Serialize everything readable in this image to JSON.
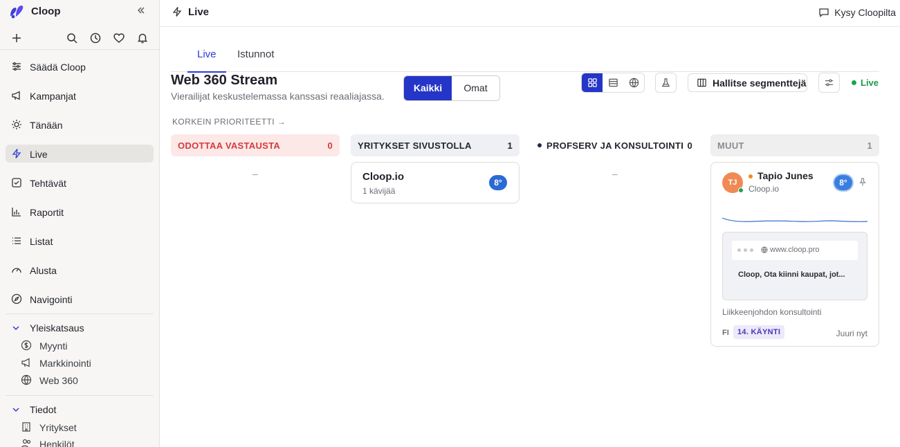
{
  "app": {
    "name": "Cloop",
    "accent": "#2535c7"
  },
  "sidebar": {
    "items": [
      {
        "label": "Säädä Cloop",
        "icon": "sliders-icon"
      },
      {
        "label": "Kampanjat",
        "icon": "megaphone-icon"
      },
      {
        "label": "Tänään",
        "icon": "sun-icon"
      },
      {
        "label": "Live",
        "icon": "bolt-icon",
        "active": true
      },
      {
        "label": "Tehtävät",
        "icon": "checkbox-icon"
      },
      {
        "label": "Raportit",
        "icon": "bar-chart-icon"
      },
      {
        "label": "Listat",
        "icon": "list-icon"
      },
      {
        "label": "Alusta",
        "icon": "gauge-icon"
      },
      {
        "label": "Navigointi",
        "icon": "compass-icon"
      }
    ],
    "groups": [
      {
        "label": "Yleiskatsaus",
        "items": [
          {
            "label": "Myynti",
            "icon": "dollar-icon"
          },
          {
            "label": "Markkinointi",
            "icon": "megaphone-icon"
          },
          {
            "label": "Web 360",
            "icon": "globe-icon"
          }
        ]
      },
      {
        "label": "Tiedot",
        "items": [
          {
            "label": "Yritykset",
            "icon": "building-icon"
          },
          {
            "label": "Henkilöt",
            "icon": "users-icon"
          }
        ]
      }
    ]
  },
  "topbar": {
    "title": "Live",
    "ask_label": "Kysy Cloopilta"
  },
  "tabs": [
    {
      "label": "Live",
      "active": true
    },
    {
      "label": "Istunnot"
    }
  ],
  "stream": {
    "title": "Web 360 Stream",
    "subtitle": "Vierailijat keskustelemassa kanssasi reaaliajassa.",
    "filter": {
      "all": "Kaikki",
      "own": "Omat"
    },
    "manage_segments": "Hallitse segmenttejä",
    "live_label": "Live",
    "priority_label": "KORKEIN PRIORITEETTI →"
  },
  "columns": [
    {
      "title": "ODOTTAA VASTAUSTA",
      "count": "0",
      "empty": "–"
    },
    {
      "title": "YRITYKSET SIVUSTOLLA",
      "count": "1"
    },
    {
      "title": "PROFSERV JA KONSULTOINTI",
      "count": "0",
      "empty": "–"
    },
    {
      "title": "MUUT",
      "count": "1"
    }
  ],
  "company_card": {
    "name": "Cloop.io",
    "visitors": "1 kävijää",
    "score": "8°"
  },
  "visitor_card": {
    "initials": "TJ",
    "name": "Tapio Junes",
    "company": "Cloop.io",
    "score": "8°",
    "url": "www.cloop.pro",
    "page_title": "Cloop, Ota kiinni kaupat, jot...",
    "industry": "Liikkeenjohdon konsultointi",
    "lang": "FI",
    "visit": "14. KÄYNTI",
    "time": "Juuri nyt"
  }
}
